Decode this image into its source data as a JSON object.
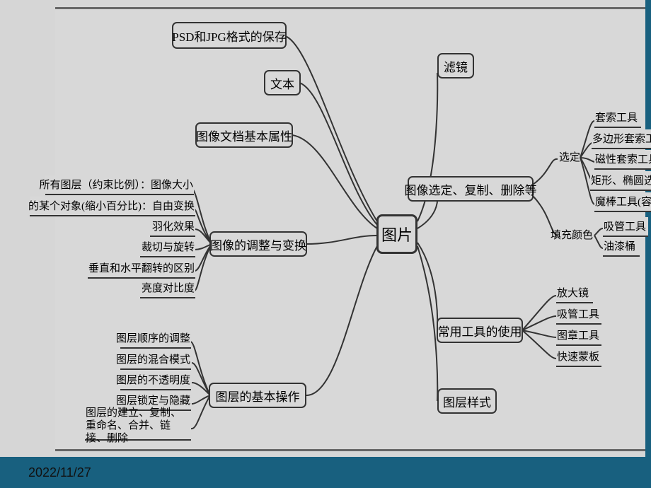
{
  "footer": {
    "date": "2022/11/27"
  },
  "mindmap": {
    "center": "图片",
    "left": {
      "psd_jpg": {
        "label": "PSD和JPG格式的保存"
      },
      "text": {
        "label": "文本"
      },
      "doc_attr": {
        "label": "图像文档基本属性"
      },
      "adjust": {
        "label": "图像的调整与变换",
        "children": [
          "所有图层（约束比例）：图像大小",
          "的某个对象(缩小百分比)：自由变换",
          "羽化效果",
          "裁切与旋转",
          "垂直和水平翻转的区别",
          "亮度对比度"
        ]
      },
      "layer_ops": {
        "label": "图层的基本操作",
        "children": [
          "图层顺序的调整",
          "图层的混合模式",
          "图层的不透明度",
          "图层锁定与隐藏",
          "图层的建立、复制、重命名、合并、链接、删除"
        ]
      }
    },
    "right": {
      "filter": {
        "label": "滤镜"
      },
      "select_copy": {
        "label": "图像选定、复制、删除等",
        "groups": {
          "select_label": "选定",
          "select": [
            "套索工具",
            "多边形套索工具",
            "磁性套索工具",
            "矩形、椭圆选框工",
            "魔棒工具(容差)"
          ],
          "fill_label": "填充颜色",
          "fill": [
            "吸管工具",
            "油漆桶"
          ]
        }
      },
      "tools": {
        "label": "常用工具的使用",
        "children": [
          "放大镜",
          "吸管工具",
          "图章工具",
          "快速蒙板"
        ]
      },
      "layer_style": {
        "label": "图层样式"
      }
    }
  }
}
